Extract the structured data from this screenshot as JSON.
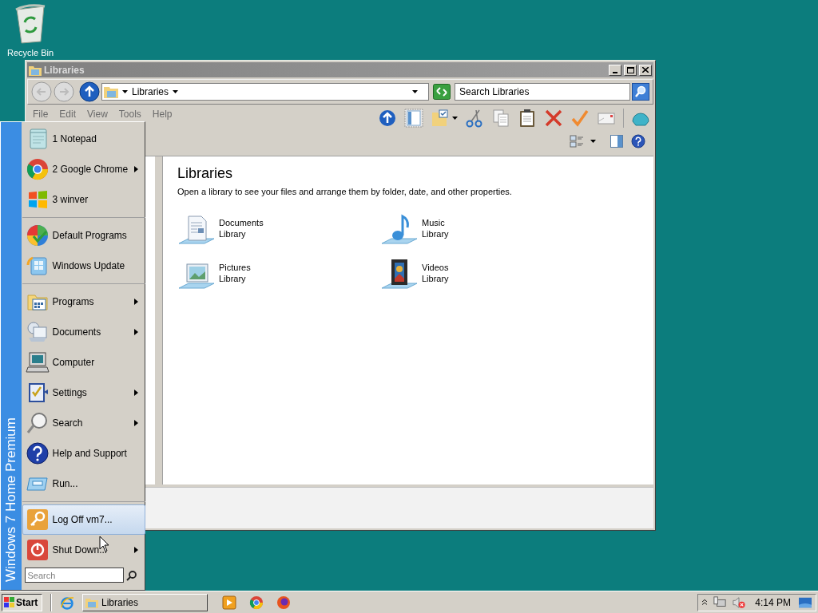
{
  "desktop_icons": [
    {
      "label": "Recycle Bin"
    }
  ],
  "window": {
    "title": "Libraries",
    "address": "Libraries",
    "search": {
      "placeholder": "Search Libraries"
    },
    "menu": [
      {
        "label": "File",
        "disabled": true
      },
      {
        "label": "Edit",
        "disabled": true
      },
      {
        "label": "View",
        "disabled": true
      },
      {
        "label": "Tools",
        "disabled": true
      },
      {
        "label": "Help",
        "disabled": true
      }
    ],
    "heading": "Libraries",
    "description": "Open a library to see your files and arrange them by folder, date, and other properties.",
    "libraries": [
      {
        "kind": "documents",
        "name": "Documents",
        "type": "Library"
      },
      {
        "kind": "music",
        "name": "Music",
        "type": "Library"
      },
      {
        "kind": "pictures",
        "name": "Pictures",
        "type": "Library"
      },
      {
        "kind": "videos",
        "name": "Videos",
        "type": "Library"
      }
    ]
  },
  "start_menu": {
    "banner": "Windows 7 Home Premium",
    "groups": [
      [
        {
          "kind": "notepad",
          "label": "1 Notepad",
          "submenu": false,
          "selected": false
        },
        {
          "kind": "chrome",
          "label": "2 Google Chrome",
          "submenu": true,
          "selected": false
        },
        {
          "kind": "winver",
          "label": "3 winver",
          "submenu": false,
          "selected": false
        }
      ],
      [
        {
          "kind": "defaults",
          "label": "Default Programs",
          "submenu": false,
          "selected": false
        },
        {
          "kind": "update",
          "label": "Windows Update",
          "submenu": false,
          "selected": false
        }
      ],
      [
        {
          "kind": "programs",
          "label": "Programs",
          "submenu": true,
          "selected": false
        },
        {
          "kind": "documents",
          "label": "Documents",
          "submenu": true,
          "selected": false
        },
        {
          "kind": "computer",
          "label": "Computer",
          "submenu": false,
          "selected": false
        },
        {
          "kind": "settings",
          "label": "Settings",
          "submenu": true,
          "selected": false
        },
        {
          "kind": "search",
          "label": "Search",
          "submenu": true,
          "selected": false
        },
        {
          "kind": "help",
          "label": "Help and Support",
          "submenu": false,
          "selected": false
        },
        {
          "kind": "run",
          "label": "Run...",
          "submenu": false,
          "selected": false
        }
      ],
      [
        {
          "kind": "logoff",
          "label": "Log Off vm7...",
          "submenu": false,
          "selected": true
        },
        {
          "kind": "shutdown",
          "label": "Shut Down...",
          "submenu": true,
          "selected": false
        }
      ]
    ],
    "search": {
      "placeholder": "Search"
    }
  },
  "taskbar": {
    "start": "Start",
    "tasks": [
      {
        "label": "Libraries",
        "selected": false
      }
    ],
    "clock": "4:14 PM"
  }
}
